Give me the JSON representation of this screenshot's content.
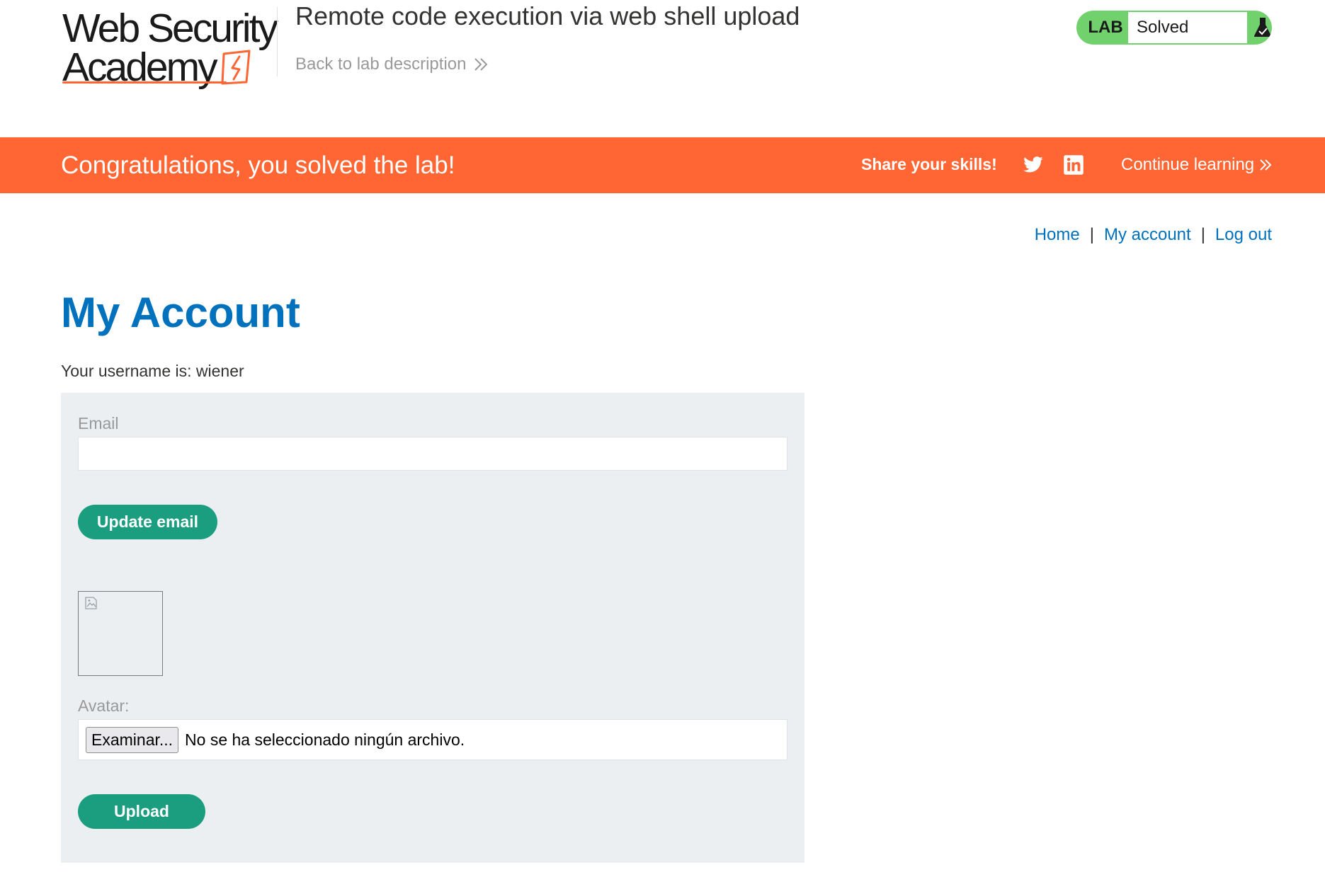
{
  "header": {
    "logo": {
      "line1": "Web Security",
      "line2": "Academy",
      "icon": "lightning-bolt-icon",
      "brand_color": "#ff6633"
    },
    "lab_title": "Remote code execution via web shell upload",
    "back_link": "Back to lab description",
    "back_icon": "double-chevron-right-icon",
    "lab_status": {
      "label": "LAB",
      "status": "Solved",
      "icon": "flask-icon",
      "color": "#70d16d"
    }
  },
  "notification": {
    "message": "Congratulations, you solved the lab!",
    "share_label": "Share your skills!",
    "share_icons": [
      "twitter-icon",
      "linkedin-icon"
    ],
    "continue_label": "Continue learning",
    "color": "#ff6633"
  },
  "nav": {
    "items": [
      "Home",
      "My account",
      "Log out"
    ],
    "separator": "|",
    "link_color": "#0071bc"
  },
  "main": {
    "heading": "My Account",
    "username_text": "Your username is: wiener",
    "email_form": {
      "label": "Email",
      "value": "",
      "button": "Update email"
    },
    "avatar_form": {
      "image_icon": "broken-image-icon",
      "label": "Avatar:",
      "file_button": "Examinar...",
      "file_status": "No se ha seleccionado ningún archivo.",
      "upload_button": "Upload"
    },
    "button_color": "#1a9e7f",
    "panel_color": "#ebeff2"
  }
}
